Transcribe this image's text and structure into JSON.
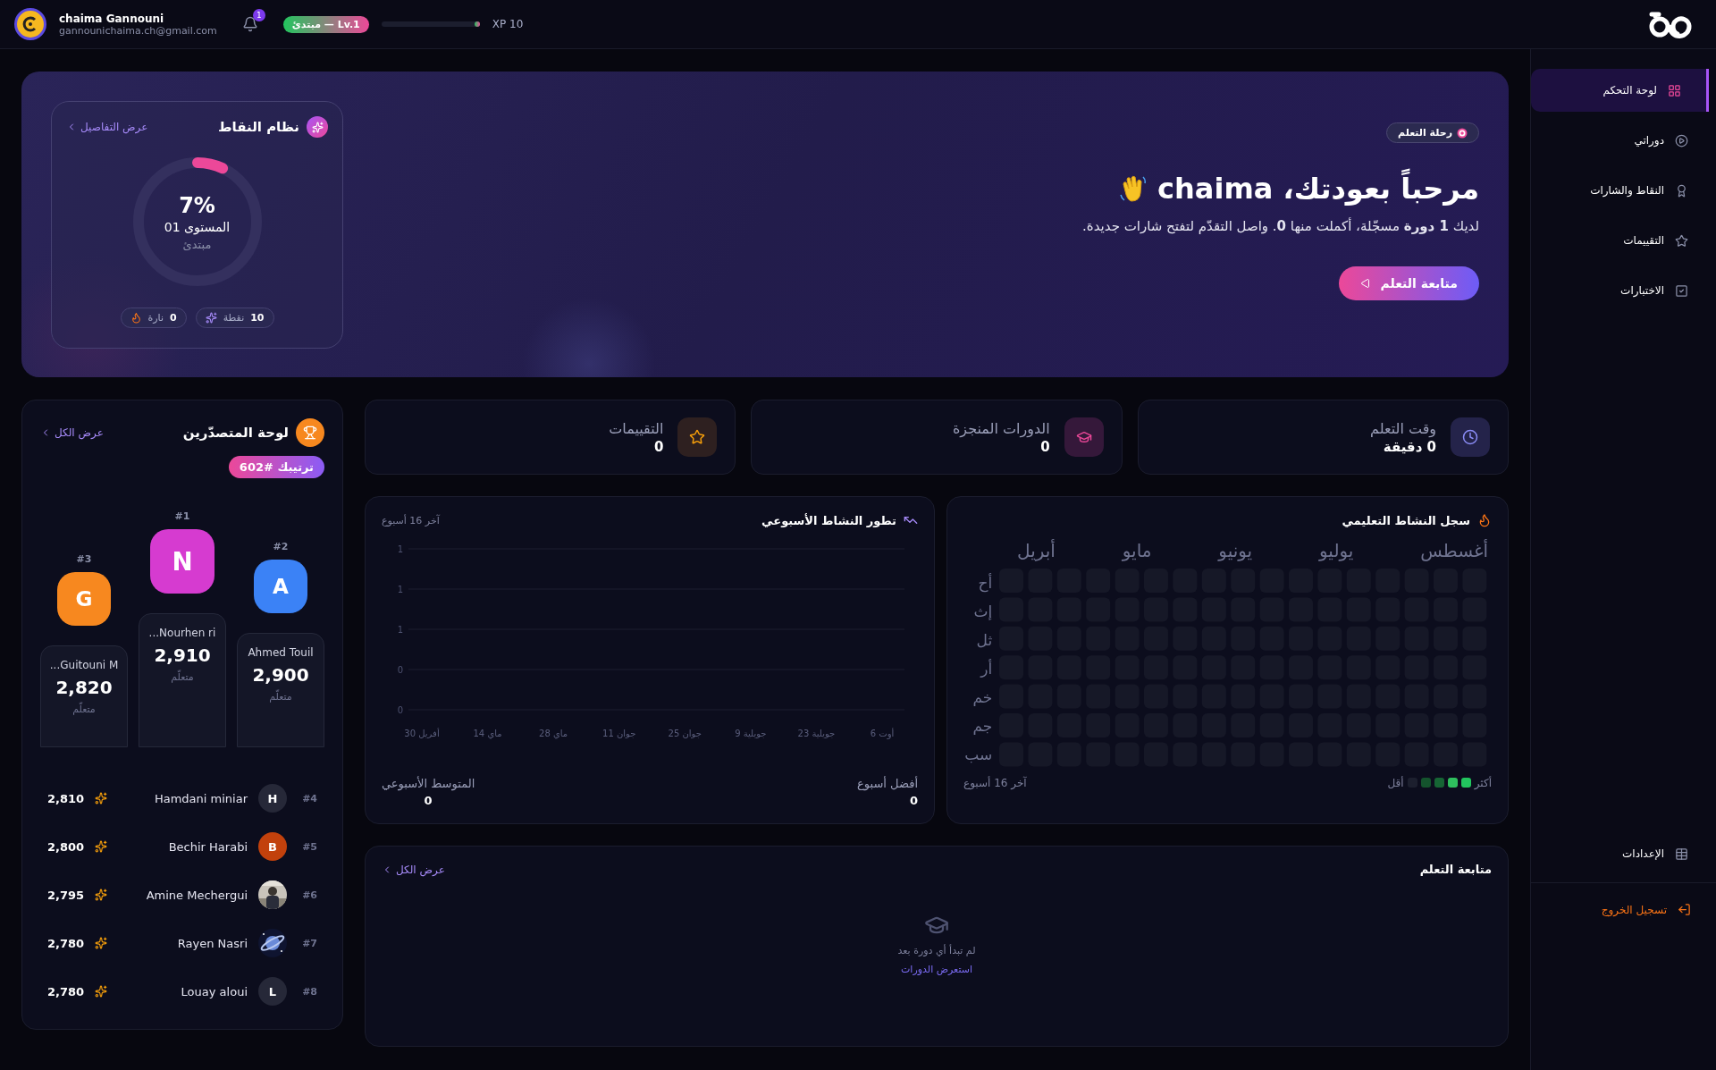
{
  "topbar": {
    "user": {
      "name": "chaima Gannouni",
      "email": "gannounichaima.ch@gmail.com"
    },
    "notifications": {
      "count": "1"
    },
    "level_badge": "Lv.1 — مبتدئ",
    "xp": {
      "level": 0.03,
      "label": "XP 10"
    }
  },
  "sidebar": {
    "items": [
      {
        "kind": "dashboard",
        "label": "لوحة التحكم",
        "selected": true
      },
      {
        "kind": "courses",
        "label": "دوراتي",
        "selected": false
      },
      {
        "kind": "badges",
        "label": "النقاط والشارات",
        "selected": false
      },
      {
        "kind": "ratings",
        "label": "التقييمات",
        "selected": false
      },
      {
        "kind": "quizzes",
        "label": "الاختبارات",
        "selected": false
      }
    ],
    "settings": "الإعدادات",
    "logout": "تسجيل الخروج"
  },
  "hero": {
    "badge": "رحلة التعلم",
    "title": "مرحباً بعودتك، chaima",
    "subtitle": "لديك **1 دورة** مسجّلة، أكملت منها **0**. واصل التقدّم لتفتح شارات جديدة.",
    "button": "متابعة التعلم",
    "points": {
      "title": "نظام النقاط",
      "link": "عرض التفاصيل",
      "ring": {
        "level": 0.07,
        "percent": "7%",
        "level_label": "المستوى 01",
        "rank": "مبتدئ"
      },
      "chips": [
        {
          "kind": "points",
          "value": "10",
          "label": "نقطة"
        },
        {
          "kind": "streak",
          "value": "0",
          "label": "نارة"
        }
      ]
    }
  },
  "stats": [
    {
      "kind": "time",
      "label": "وقت التعلم",
      "value": "0 دقيقة"
    },
    {
      "kind": "courses",
      "label": "الدورات المنجزة",
      "value": "0"
    },
    {
      "kind": "ratings",
      "label": "التقييمات",
      "value": "0"
    }
  ],
  "leaderboard": {
    "title": "لوحة المتصدّرين",
    "link": "عرض الكل",
    "my_rank": "ترتيبك #602",
    "podium": [
      {
        "kind": "second",
        "rank": "#2",
        "letter": "A",
        "name": "Ahmed Touil",
        "score": "2,900",
        "role": "متعلّم",
        "color": "#3b82f6"
      },
      {
        "kind": "first",
        "rank": "#1",
        "letter": "N",
        "name": "Nourhen ri...",
        "score": "2,910",
        "role": "متعلّم",
        "color": "#d63bd0"
      },
      {
        "kind": "third",
        "rank": "#3",
        "letter": "G",
        "name": "Guitouni M...",
        "score": "2,820",
        "role": "متعلّم",
        "color": "#f7881f"
      }
    ],
    "rows": [
      {
        "rank": "#4",
        "avatar": {
          "kind": "letter",
          "letter": "H",
          "color": "#262838"
        },
        "name": "Hamdani miniar",
        "score": "2,810"
      },
      {
        "rank": "#5",
        "avatar": {
          "kind": "letter",
          "letter": "B",
          "color": "#c2410c"
        },
        "name": "Bechir Harabi",
        "score": "2,800"
      },
      {
        "rank": "#6",
        "name": "Amine Mechergui",
        "score": "2,795"
      },
      {
        "rank": "#7",
        "name": "Rayen Nasri",
        "score": "2,780"
      },
      {
        "rank": "#8",
        "avatar": {
          "kind": "letter",
          "letter": "L",
          "color": "#262838"
        },
        "name": "Louay aloui",
        "score": "2,780"
      }
    ]
  },
  "weekly_chart": {
    "title": "تطور النشاط الأسبوعي",
    "range": "آخر 16 أسبوع",
    "chart_data": {
      "type": "line",
      "categories": [
        "30 أفريل",
        "14 ماي",
        "28 ماي",
        "11 جوان",
        "25 جوان",
        "9 جويلية",
        "23 جويلية",
        "6 أوت"
      ],
      "grid": true,
      "ylim": [
        0,
        1
      ],
      "yticks": [
        {
          "value": 1,
          "label": "1"
        },
        {
          "value": 0.75,
          "label": "1"
        },
        {
          "value": 0.5,
          "label": "1"
        },
        {
          "value": 0.25,
          "label": "0"
        },
        {
          "value": 0,
          "label": "0"
        }
      ]
    },
    "best": {
      "label": "أفضل أسبوع",
      "value": "0"
    },
    "average": {
      "label": "المتوسط الأسبوعي",
      "value": "0"
    }
  },
  "heatmap": {
    "title": "سجل النشاط التعليمي",
    "months": [
      "أغسطس",
      "يوليو",
      "يونيو",
      "مايو",
      "أبريل"
    ],
    "days": [
      "أح",
      "إث",
      "ثل",
      "أر",
      "خم",
      "جم",
      "سب"
    ],
    "range": "آخر 16 أسبوع",
    "legend": {
      "more": "أكثر",
      "less": "أقل",
      "swatches": [
        {
          "color": "#22c55e"
        },
        {
          "color": "#2fbf5e"
        },
        {
          "color": "#166534"
        },
        {
          "color": "#14532d"
        },
        {
          "color": "#1c1f2e"
        }
      ]
    }
  },
  "continue": {
    "title": "متابعة التعلم",
    "link": "عرض الكل",
    "empty": "لم تبدأ أي دورة بعد",
    "browse": "استعرض الدورات"
  }
}
